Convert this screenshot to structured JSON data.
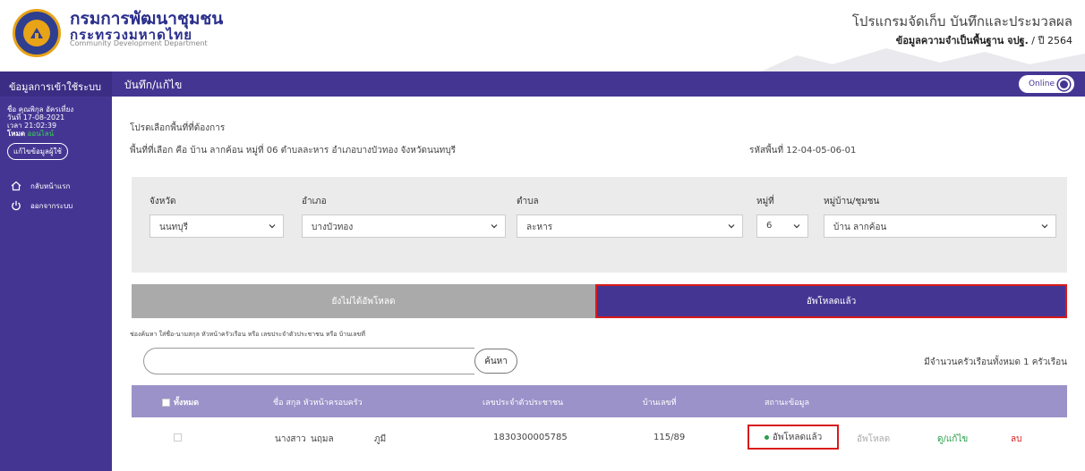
{
  "header": {
    "org_name_line1": "กรมการพัฒนาชุมชน",
    "org_name_line2": "กระทรวงมหาดไทย",
    "org_name_en": "Community Development Department",
    "program_title": "โปรแกรมจัดเก็บ บันทึกและประมวลผล",
    "program_subtitle_prefix": "ข้อมูลความจำเป็นพื้นฐาน จปฐ.",
    "program_subtitle_year": " / ปี 2564"
  },
  "sidebar": {
    "title": "ข้อมูลการเข้าใช้ระบบ",
    "user_name": "ชื่อ คุณพิกุล อัครเที่ยง",
    "date": "วันที่ 17-08-2021",
    "time": "เวลา 21:02:39",
    "mode_label": "โหมด",
    "mode_value": "ออนไลน์",
    "edit_profile_label": "แก้ไขข้อมูลผู้ใช้",
    "items": [
      {
        "label": "กลับหน้าแรก",
        "icon": "home-icon"
      },
      {
        "label": "ออกจากระบบ",
        "icon": "power-icon"
      }
    ]
  },
  "topbar": {
    "title": "บันทึก/แก้ไข",
    "online_label": "Online"
  },
  "main": {
    "prompt": "โปรดเลือกพื้นที่ที่ต้องการ",
    "selected_area": "พื้นที่ที่เลือก คือ บ้าน ลากค้อน หมู่ที่ 06 ตำบลละหาร อำเภอบางบัวทอง จังหวัดนนทบุรี",
    "area_code": "รหัสพื้นที่ 12-04-05-06-01",
    "filters": {
      "province": {
        "label": "จังหวัด",
        "value": "นนทบุรี"
      },
      "district": {
        "label": "อำเภอ",
        "value": "บางบัวทอง"
      },
      "subdistrict": {
        "label": "ตำบล",
        "value": "ละหาร"
      },
      "moo": {
        "label": "หมู่ที่",
        "value": "6"
      },
      "village": {
        "label": "หมู่บ้าน/ชุมชน",
        "value": "บ้าน ลากค้อน"
      }
    },
    "tabs": {
      "pending": "ยังไม่ได้อัพโหลด",
      "uploaded": "อัพโหลดแล้ว"
    },
    "search_hint": "ช่องค้นหา ใส่ชื่อ-นามสกุล หัวหน้าครัวเรือน หรือ เลขประจำตัวประชาชน หรือ บ้านเลขที่",
    "search_placeholder": "",
    "search_button": "ค้นหา",
    "count_text": "มีจำนวนครัวเรือนทั้งหมด 1 ครัวเรือน",
    "table": {
      "headers": {
        "all": "ทั้งหมด",
        "name": "ชื่อ สกุล หัวหน้าครอบครัว",
        "id": "เลขประจำตัวประชาชน",
        "house_no": "บ้านเลขที่",
        "status": "สถานะข้อมูล"
      },
      "rows": [
        {
          "title": "นางสาว",
          "first_name": "นฤมล",
          "last_name": "ภูมี",
          "id": "1830300005785",
          "house_no": "115/89",
          "status": "อัพโหลดแล้ว",
          "action_upload": "อัพโหลด",
          "action_view": "ดู/แก้ไข",
          "action_delete": "ลบ"
        }
      ]
    }
  },
  "colors": {
    "primary": "#453593",
    "header_row": "#9b92c9",
    "highlight": "#d81b1b",
    "tab_inactive": "#aaaaaa",
    "success": "#2a9d4a"
  }
}
